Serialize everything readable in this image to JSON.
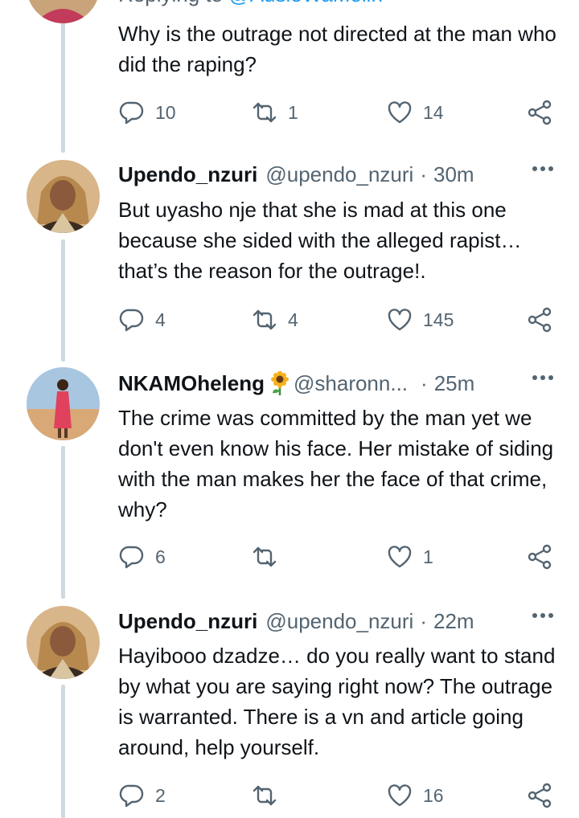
{
  "top_tweet": {
    "reply_context_prefix": "Replying to",
    "reply_context_mention": "@AusieWaMolin",
    "text": "Why is the outrage not directed at the man who did the raping?",
    "replies": "10",
    "retweets": "1",
    "likes": "14"
  },
  "tweets": [
    {
      "name": "Upendo_nzuri",
      "handle": "@upendo_nzuri",
      "separator": "·",
      "time": "30m",
      "text": "But uyasho nje that she is mad at this one because she sided with the alleged rapist… that’s the reason for the outrage!.",
      "replies": "4",
      "retweets": "4",
      "likes": "145"
    },
    {
      "name": "NKAMOheleng",
      "emoji": "sunflower-icon",
      "handle": "@sharonn...",
      "separator": "·",
      "time": "25m",
      "text": "The crime was committed by the man yet we don't even know his face. Her mistake of siding with the man makes her the face of that crime, why?",
      "replies": "6",
      "retweets": "",
      "likes": "1"
    },
    {
      "name": "Upendo_nzuri",
      "handle": "@upendo_nzuri",
      "separator": "·",
      "time": "22m",
      "text": "Hayibooo dzadze… do you really want to stand by what you are saying right now? The outrage is warranted. There is a vn and article going around, help yourself.",
      "replies": "2",
      "retweets": "",
      "likes": "16"
    }
  ],
  "colors": {
    "text": "#0f1419",
    "secondary": "#536471",
    "thread_line": "#cfd9de",
    "mention": "#1d9bf0"
  }
}
